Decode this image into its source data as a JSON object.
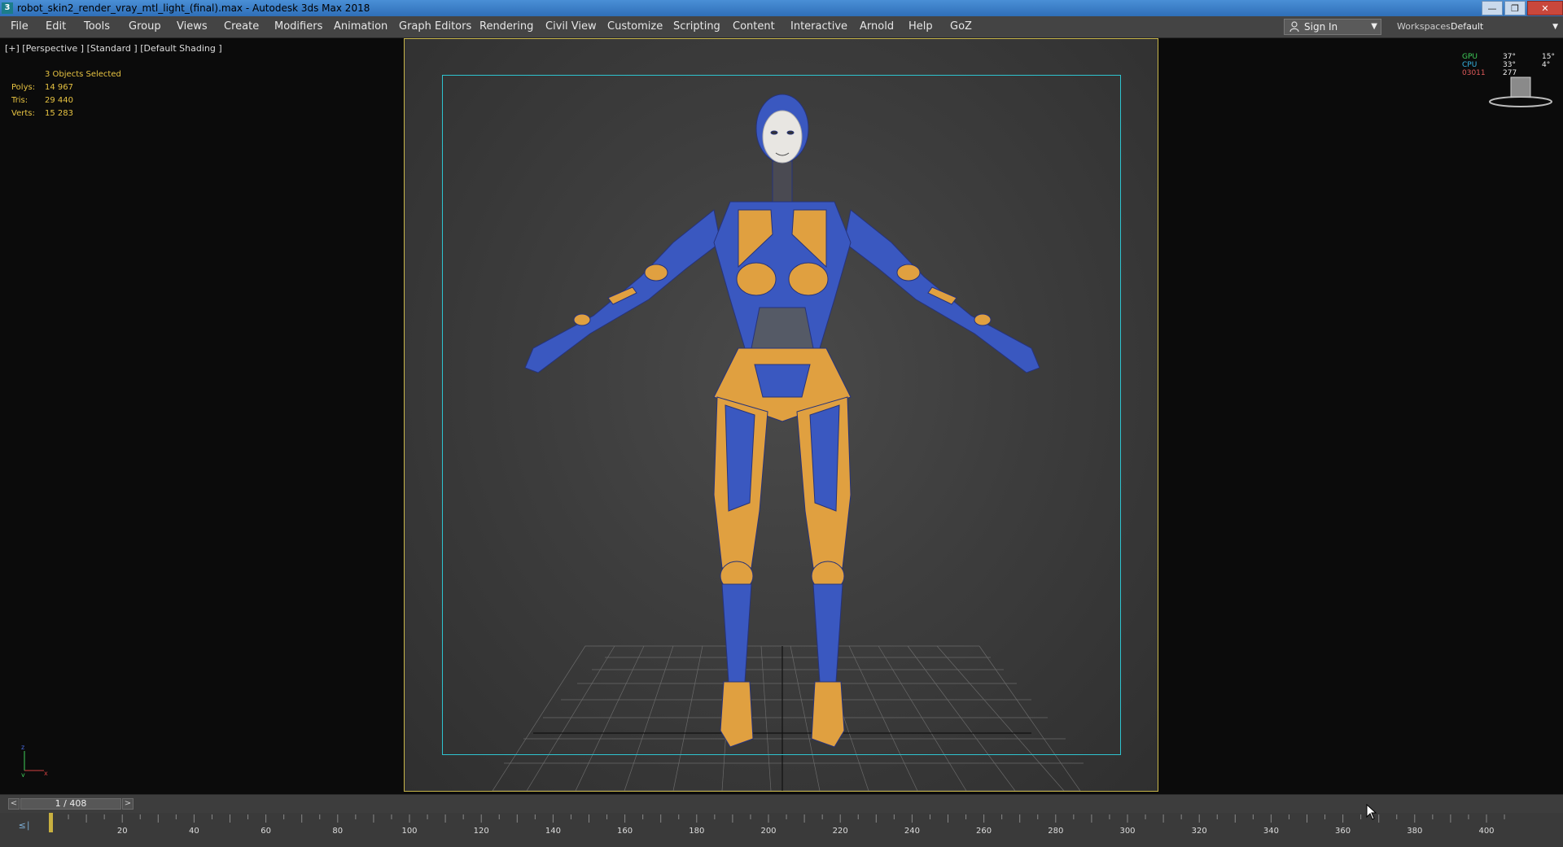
{
  "titlebar": {
    "title": "robot_skin2_render_vray_mtl_light_(final).max - Autodesk 3ds Max 2018",
    "app_icon": "3",
    "buttons": [
      "minimize",
      "restore",
      "close"
    ]
  },
  "menubar": {
    "items": [
      "File",
      "Edit",
      "Tools",
      "Group",
      "Views",
      "Create",
      "Modifiers",
      "Animation",
      "Graph Editors",
      "Rendering",
      "Civil View",
      "Customize",
      "Scripting",
      "Content",
      "Interactive",
      "Arnold",
      "Help",
      "GoZ"
    ],
    "sign_in": "Sign In",
    "workspaces_label": "Workspaces:",
    "workspaces_value": "Default"
  },
  "viewport": {
    "label": "[+] [Perspective ] [Standard ] [Default Shading ]",
    "selection": "3 Objects Selected",
    "stats": [
      {
        "key": "Polys:",
        "value": "14 967"
      },
      {
        "key": "Tris:",
        "value": "29 440"
      },
      {
        "key": "Verts:",
        "value": "15 283"
      }
    ],
    "hud": {
      "gpu_label": "GPU",
      "cpu_label": "CPU",
      "fps_label": "03011",
      "gpu_temp": "37°",
      "cpu_temp": "33°",
      "fps_value": "277",
      "extra1": "15°",
      "extra2": "4°"
    },
    "axis": {
      "x": "x",
      "y": "y",
      "z": "z"
    },
    "colors": {
      "safe_frame": "#c8b64a",
      "render_region": "#2ec3cf",
      "robot_blue": "#3a58c0",
      "robot_orange": "#e0a040"
    }
  },
  "timeslider": {
    "frame_label": "1 / 408",
    "prev": "<",
    "next": ">",
    "position": 0.0
  },
  "trackbar": {
    "curve_icon": "curve-editor-icon",
    "ticks": [
      "20",
      "40",
      "60",
      "80",
      "100",
      "120",
      "140",
      "160",
      "180",
      "200",
      "220",
      "240",
      "260",
      "280",
      "300",
      "320",
      "340",
      "360",
      "380",
      "400"
    ]
  }
}
